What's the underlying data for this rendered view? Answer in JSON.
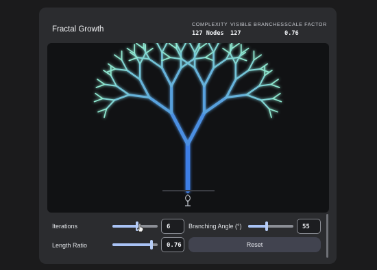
{
  "app": {
    "title": "Fractal Growth"
  },
  "stats": [
    {
      "label": "COMPLEXITY",
      "value": "127 Nodes"
    },
    {
      "label": "VISIBLE BRANCHES",
      "value": "127"
    },
    {
      "label": "SCALE FACTOR",
      "value": "0.76"
    }
  ],
  "canvas": {
    "iterations": 6,
    "branching_angle_deg": 55,
    "length_ratio": 0.76,
    "colors": {
      "trunk": "#3d7ee6",
      "tips": "#8ee6cf",
      "background": "#111214"
    },
    "reset_icon": "seedling-icon"
  },
  "controls": {
    "iterations": {
      "label": "Iterations",
      "value": "6",
      "fraction": 0.55
    },
    "angle": {
      "label": "Branching Angle (°)",
      "value": "55",
      "fraction": 0.41
    },
    "length_ratio": {
      "label": "Length Ratio",
      "value": "0.76",
      "fraction": 0.86
    },
    "reset_label": "Reset"
  }
}
